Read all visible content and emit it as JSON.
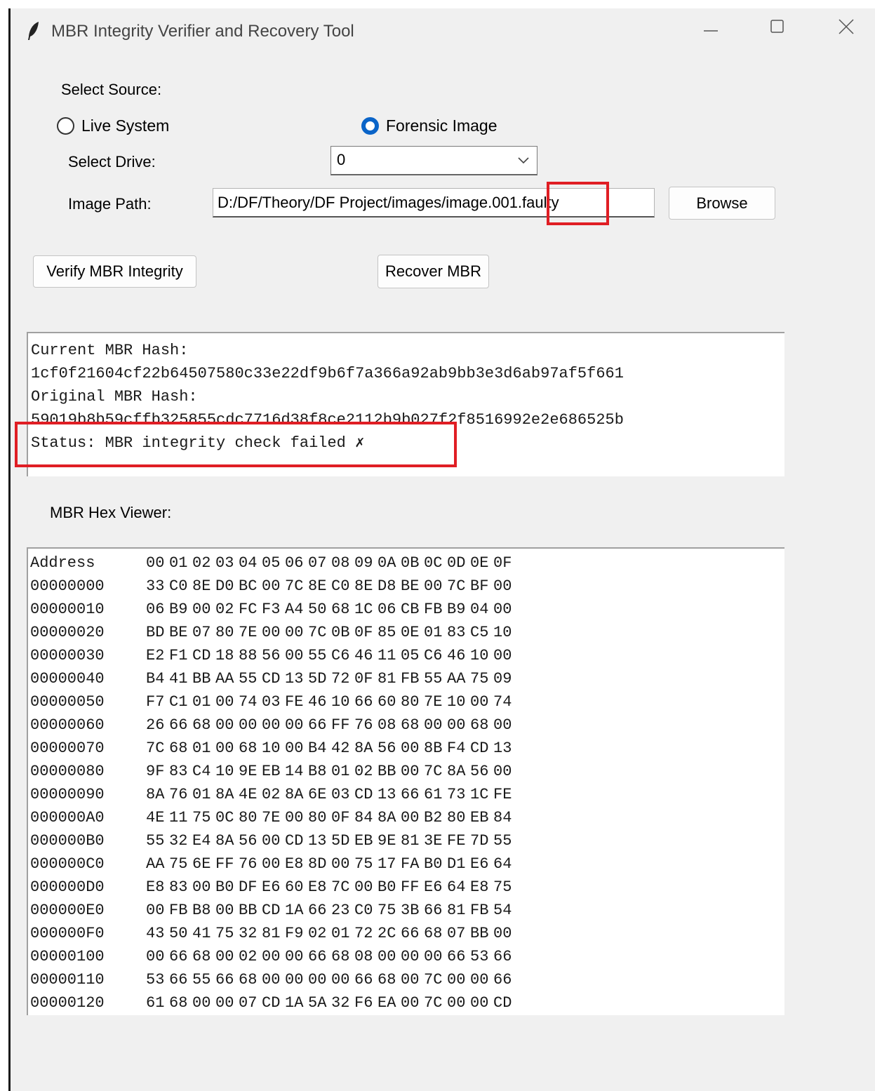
{
  "window": {
    "title": "MBR Integrity Verifier and Recovery Tool"
  },
  "source": {
    "heading": "Select Source:",
    "options": [
      "Live System",
      "Forensic Image"
    ],
    "selected": "Forensic Image"
  },
  "drive": {
    "label": "Select Drive:",
    "value": "0"
  },
  "image": {
    "label": "Image Path:",
    "path": "D:/DF/Theory/DF Project/images/image.001.faulty",
    "browse_label": "Browse"
  },
  "actions": {
    "verify_label": "Verify MBR Integrity",
    "recover_label": "Recover MBR"
  },
  "hash_output": {
    "lines": [
      "Current MBR Hash:",
      "1cf0f21604cf22b64507580c33e22df9b6f7a366a92ab9bb3e3d6ab97af5f661",
      "Original MBR Hash:",
      "59019b8b59cffb325855cdc7716d38f8ce2112b9b027f2f8516992e2e686525b",
      "Status: MBR integrity check failed ✗"
    ]
  },
  "hex_viewer": {
    "label": "MBR Hex Viewer:",
    "header": {
      "address": "Address",
      "columns": [
        "00",
        "01",
        "02",
        "03",
        "04",
        "05",
        "06",
        "07",
        "08",
        "09",
        "0A",
        "0B",
        "0C",
        "0D",
        "0E",
        "0F"
      ]
    },
    "rows": [
      {
        "address": "00000000",
        "bytes": [
          "33",
          "C0",
          "8E",
          "D0",
          "BC",
          "00",
          "7C",
          "8E",
          "C0",
          "8E",
          "D8",
          "BE",
          "00",
          "7C",
          "BF",
          "00"
        ]
      },
      {
        "address": "00000010",
        "bytes": [
          "06",
          "B9",
          "00",
          "02",
          "FC",
          "F3",
          "A4",
          "50",
          "68",
          "1C",
          "06",
          "CB",
          "FB",
          "B9",
          "04",
          "00"
        ]
      },
      {
        "address": "00000020",
        "bytes": [
          "BD",
          "BE",
          "07",
          "80",
          "7E",
          "00",
          "00",
          "7C",
          "0B",
          "0F",
          "85",
          "0E",
          "01",
          "83",
          "C5",
          "10"
        ]
      },
      {
        "address": "00000030",
        "bytes": [
          "E2",
          "F1",
          "CD",
          "18",
          "88",
          "56",
          "00",
          "55",
          "C6",
          "46",
          "11",
          "05",
          "C6",
          "46",
          "10",
          "00"
        ]
      },
      {
        "address": "00000040",
        "bytes": [
          "B4",
          "41",
          "BB",
          "AA",
          "55",
          "CD",
          "13",
          "5D",
          "72",
          "0F",
          "81",
          "FB",
          "55",
          "AA",
          "75",
          "09"
        ]
      },
      {
        "address": "00000050",
        "bytes": [
          "F7",
          "C1",
          "01",
          "00",
          "74",
          "03",
          "FE",
          "46",
          "10",
          "66",
          "60",
          "80",
          "7E",
          "10",
          "00",
          "74"
        ]
      },
      {
        "address": "00000060",
        "bytes": [
          "26",
          "66",
          "68",
          "00",
          "00",
          "00",
          "00",
          "66",
          "FF",
          "76",
          "08",
          "68",
          "00",
          "00",
          "68",
          "00"
        ]
      },
      {
        "address": "00000070",
        "bytes": [
          "7C",
          "68",
          "01",
          "00",
          "68",
          "10",
          "00",
          "B4",
          "42",
          "8A",
          "56",
          "00",
          "8B",
          "F4",
          "CD",
          "13"
        ]
      },
      {
        "address": "00000080",
        "bytes": [
          "9F",
          "83",
          "C4",
          "10",
          "9E",
          "EB",
          "14",
          "B8",
          "01",
          "02",
          "BB",
          "00",
          "7C",
          "8A",
          "56",
          "00"
        ]
      },
      {
        "address": "00000090",
        "bytes": [
          "8A",
          "76",
          "01",
          "8A",
          "4E",
          "02",
          "8A",
          "6E",
          "03",
          "CD",
          "13",
          "66",
          "61",
          "73",
          "1C",
          "FE"
        ]
      },
      {
        "address": "000000A0",
        "bytes": [
          "4E",
          "11",
          "75",
          "0C",
          "80",
          "7E",
          "00",
          "80",
          "0F",
          "84",
          "8A",
          "00",
          "B2",
          "80",
          "EB",
          "84"
        ]
      },
      {
        "address": "000000B0",
        "bytes": [
          "55",
          "32",
          "E4",
          "8A",
          "56",
          "00",
          "CD",
          "13",
          "5D",
          "EB",
          "9E",
          "81",
          "3E",
          "FE",
          "7D",
          "55"
        ]
      },
      {
        "address": "000000C0",
        "bytes": [
          "AA",
          "75",
          "6E",
          "FF",
          "76",
          "00",
          "E8",
          "8D",
          "00",
          "75",
          "17",
          "FA",
          "B0",
          "D1",
          "E6",
          "64"
        ]
      },
      {
        "address": "000000D0",
        "bytes": [
          "E8",
          "83",
          "00",
          "B0",
          "DF",
          "E6",
          "60",
          "E8",
          "7C",
          "00",
          "B0",
          "FF",
          "E6",
          "64",
          "E8",
          "75"
        ]
      },
      {
        "address": "000000E0",
        "bytes": [
          "00",
          "FB",
          "B8",
          "00",
          "BB",
          "CD",
          "1A",
          "66",
          "23",
          "C0",
          "75",
          "3B",
          "66",
          "81",
          "FB",
          "54"
        ]
      },
      {
        "address": "000000F0",
        "bytes": [
          "43",
          "50",
          "41",
          "75",
          "32",
          "81",
          "F9",
          "02",
          "01",
          "72",
          "2C",
          "66",
          "68",
          "07",
          "BB",
          "00"
        ]
      },
      {
        "address": "00000100",
        "bytes": [
          "00",
          "66",
          "68",
          "00",
          "02",
          "00",
          "00",
          "66",
          "68",
          "08",
          "00",
          "00",
          "00",
          "66",
          "53",
          "66"
        ]
      },
      {
        "address": "00000110",
        "bytes": [
          "53",
          "66",
          "55",
          "66",
          "68",
          "00",
          "00",
          "00",
          "00",
          "66",
          "68",
          "00",
          "7C",
          "00",
          "00",
          "66"
        ]
      },
      {
        "address": "00000120",
        "bytes": [
          "61",
          "68",
          "00",
          "00",
          "07",
          "CD",
          "1A",
          "5A",
          "32",
          "F6",
          "EA",
          "00",
          "7C",
          "00",
          "00",
          "CD"
        ]
      }
    ]
  },
  "colors": {
    "accent": "#0a64c8",
    "highlight": "#e01e24",
    "window_bg": "#f0f0f0"
  },
  "icons": {
    "app": "feather-icon",
    "minimize": "minimize-icon",
    "maximize": "maximize-icon",
    "close": "close-icon",
    "combo": "chevron-down-icon"
  }
}
